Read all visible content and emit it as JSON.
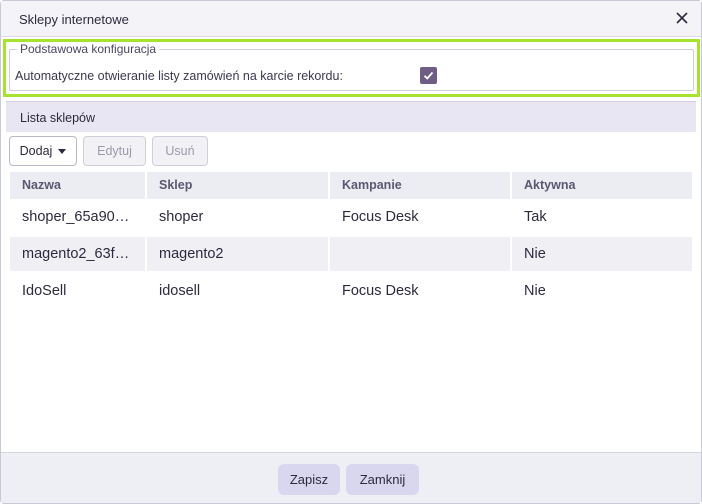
{
  "dialog": {
    "title": "Sklepy internetowe"
  },
  "config": {
    "legend": "Podstawowa konfiguracja",
    "auto_open_label": "Automatyczne otwieranie listy zamówień na karcie rekordu:",
    "auto_open_checked": true
  },
  "list": {
    "header": "Lista sklepów",
    "toolbar": {
      "add_label": "Dodaj",
      "edit_label": "Edytuj",
      "delete_label": "Usuń"
    },
    "columns": [
      "Nazwa",
      "Sklep",
      "Kampanie",
      "Aktywna"
    ],
    "rows": [
      {
        "name": "shoper_65a90…",
        "shop": "shoper",
        "campaign": "Focus Desk",
        "active": "Tak"
      },
      {
        "name": "magento2_63f…",
        "shop": "magento2",
        "campaign": "",
        "active": "Nie"
      },
      {
        "name": "IdoSell",
        "shop": "idosell",
        "campaign": "Focus Desk",
        "active": "Nie"
      }
    ]
  },
  "footer": {
    "save_label": "Zapisz",
    "close_label": "Zamknij"
  },
  "colors": {
    "highlight": "#a6e22e",
    "checkbox": "#6e5e85",
    "footer_button": "#d9d7f0"
  },
  "icons": {
    "close": "close-icon",
    "checkmark": "checkmark-icon",
    "caret": "caret-down-icon"
  }
}
